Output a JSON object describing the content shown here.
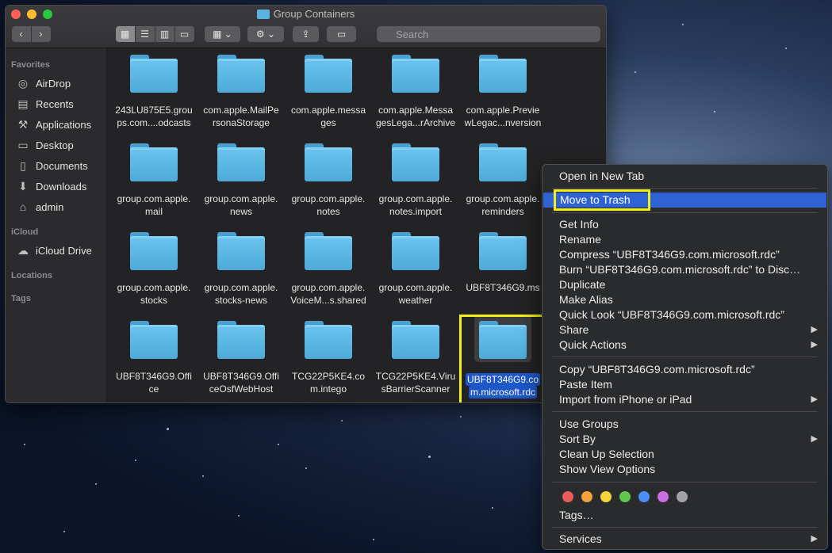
{
  "window": {
    "title": "Group Containers",
    "search_placeholder": "Search"
  },
  "toolbar": {
    "back_icon": "chevron-left-icon",
    "forward_icon": "chevron-right-icon",
    "view_modes": [
      "icon-view-icon",
      "list-view-icon",
      "column-view-icon",
      "gallery-view-icon"
    ],
    "group_icon": "group-icon",
    "action_icon": "gear-icon",
    "share_icon": "share-icon",
    "tag_icon": "tag-icon"
  },
  "sidebar": {
    "sections": [
      {
        "title": "Favorites",
        "items": [
          {
            "label": "AirDrop",
            "icon": "airdrop-icon"
          },
          {
            "label": "Recents",
            "icon": "clock-icon"
          },
          {
            "label": "Applications",
            "icon": "applications-icon"
          },
          {
            "label": "Desktop",
            "icon": "desktop-icon"
          },
          {
            "label": "Documents",
            "icon": "document-icon"
          },
          {
            "label": "Downloads",
            "icon": "download-icon"
          },
          {
            "label": "admin",
            "icon": "home-icon"
          }
        ]
      },
      {
        "title": "iCloud",
        "items": [
          {
            "label": "iCloud Drive",
            "icon": "cloud-icon"
          }
        ]
      },
      {
        "title": "Locations",
        "items": []
      },
      {
        "title": "Tags",
        "items": []
      }
    ]
  },
  "files": [
    {
      "line1": "243LU875E5.grou",
      "line2": "ps.com....odcasts"
    },
    {
      "line1": "com.apple.MailPe",
      "line2": "rsonaStorage"
    },
    {
      "line1": "com.apple.messa",
      "line2": "ges"
    },
    {
      "line1": "com.apple.Messa",
      "line2": "gesLega...rArchive"
    },
    {
      "line1": "com.apple.Previe",
      "line2": "wLegac...nversion"
    },
    {
      "line1": "group.com.apple.",
      "line2": "mail"
    },
    {
      "line1": "group.com.apple.",
      "line2": "news"
    },
    {
      "line1": "group.com.apple.",
      "line2": "notes"
    },
    {
      "line1": "group.com.apple.",
      "line2": "notes.import"
    },
    {
      "line1": "group.com.apple.",
      "line2": "reminders"
    },
    {
      "line1": "group.com.apple.",
      "line2": "stocks"
    },
    {
      "line1": "group.com.apple.",
      "line2": "stocks-news"
    },
    {
      "line1": "group.com.apple.",
      "line2": "VoiceM...s.shared"
    },
    {
      "line1": "group.com.apple.",
      "line2": "weather"
    },
    {
      "line1": "UBF8T346G9.ms",
      "line2": ""
    },
    {
      "line1": "UBF8T346G9.Offi",
      "line2": "ce"
    },
    {
      "line1": "UBF8T346G9.Offi",
      "line2": "ceOsfWebHost"
    },
    {
      "line1": "TCG22P5KE4.co",
      "line2": "m.intego"
    },
    {
      "line1": "TCG22P5KE4.Viru",
      "line2": "sBarrierScanner"
    },
    {
      "line1": "UBF8T346G9.co",
      "line2": "m.microsoft.rdc",
      "selected": true
    }
  ],
  "context_menu": {
    "items": [
      {
        "label": "Open in New Tab"
      },
      {
        "label": "Move to Trash",
        "active": true
      },
      {
        "label": "Get Info"
      },
      {
        "label": "Rename"
      },
      {
        "label": "Compress “UBF8T346G9.com.microsoft.rdc”"
      },
      {
        "label": "Burn “UBF8T346G9.com.microsoft.rdc” to Disc…"
      },
      {
        "label": "Duplicate"
      },
      {
        "label": "Make Alias"
      },
      {
        "label": "Quick Look “UBF8T346G9.com.microsoft.rdc”"
      },
      {
        "label": "Share",
        "submenu": true
      },
      {
        "label": "Quick Actions",
        "submenu": true
      },
      {
        "label": "Copy “UBF8T346G9.com.microsoft.rdc”"
      },
      {
        "label": "Paste Item"
      },
      {
        "label": "Import from iPhone or iPad",
        "submenu": true
      },
      {
        "label": "Use Groups"
      },
      {
        "label": "Sort By",
        "submenu": true
      },
      {
        "label": "Clean Up Selection"
      },
      {
        "label": "Show View Options"
      },
      {
        "label": "Tags…"
      },
      {
        "label": "Services",
        "submenu": true
      }
    ],
    "submenu_arrow": "▶",
    "tag_colors": [
      "#ec5b5b",
      "#f2a33a",
      "#f6d43c",
      "#5ec94e",
      "#4a8ff5",
      "#c96ee0",
      "#a2a2a4"
    ]
  },
  "annotations": {
    "highlight_color": "#f3f017"
  }
}
